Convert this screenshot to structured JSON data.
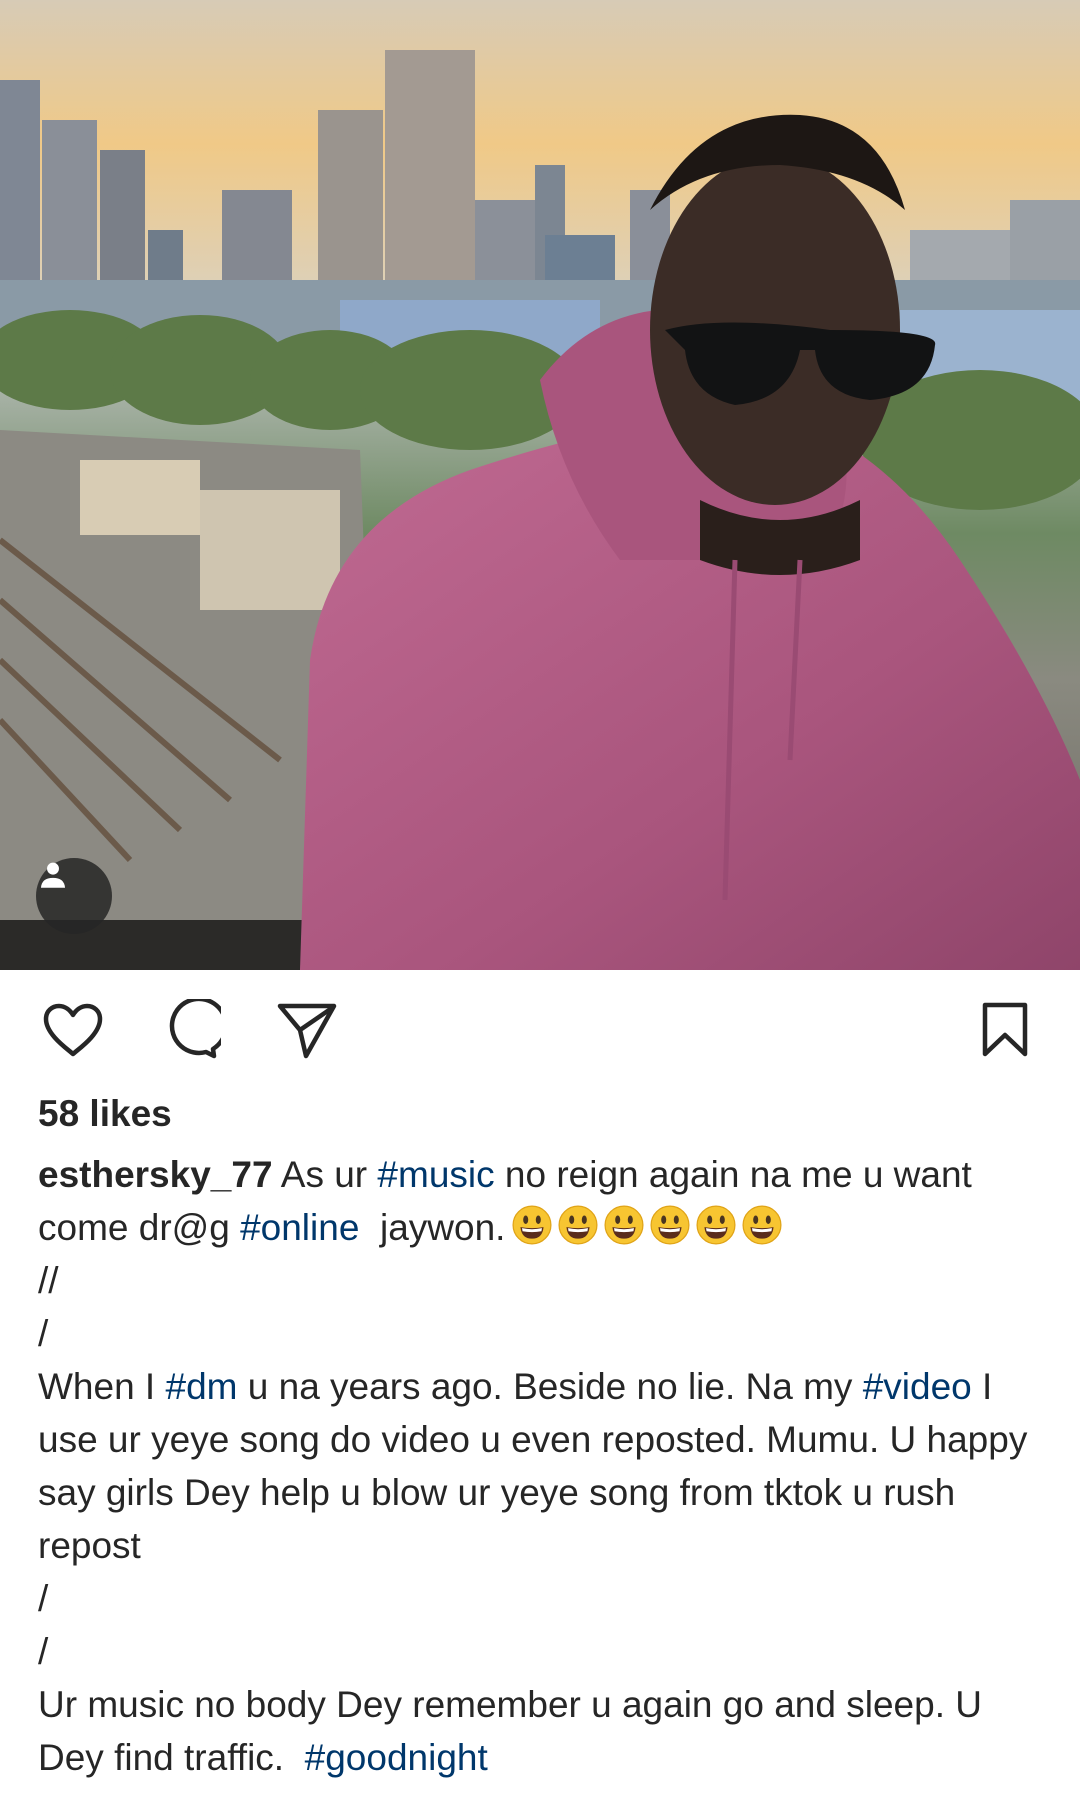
{
  "post": {
    "username": "esthersky_77",
    "likes_text": "58 likes",
    "caption": {
      "intro": " As ur ",
      "tag_music": "#music",
      "mid1": " no reign again na me u want come dr@g ",
      "tag_online": "#online",
      "mid2": "  jaywon.",
      "emoji_count": 6,
      "line_slashes": "//",
      "line_slash1": "/",
      "when_pre": "When I ",
      "tag_dm": "#dm",
      "when_mid": " u na years ago. Beside no lie. Na my ",
      "tag_video": "#video",
      "when_post": " I use ur yeye song do video u even reposted. Mumu. U happy say girls Dey help u blow ur yeye song from tktok u rush repost",
      "line_slash2": "/",
      "line_slash3": "/",
      "final_pre": "Ur music no body Dey remember u again go and sleep. U Dey find traffic.  ",
      "tag_goodnight": "#goodnight"
    }
  },
  "icons": {
    "like": "heart-icon",
    "comment": "comment-bubble-icon",
    "share": "paper-plane-icon",
    "save": "bookmark-icon",
    "tagged_people": "person-icon"
  },
  "colors": {
    "hashtag": "#00376b",
    "text": "#262626",
    "hoodie": "#b35f86"
  }
}
